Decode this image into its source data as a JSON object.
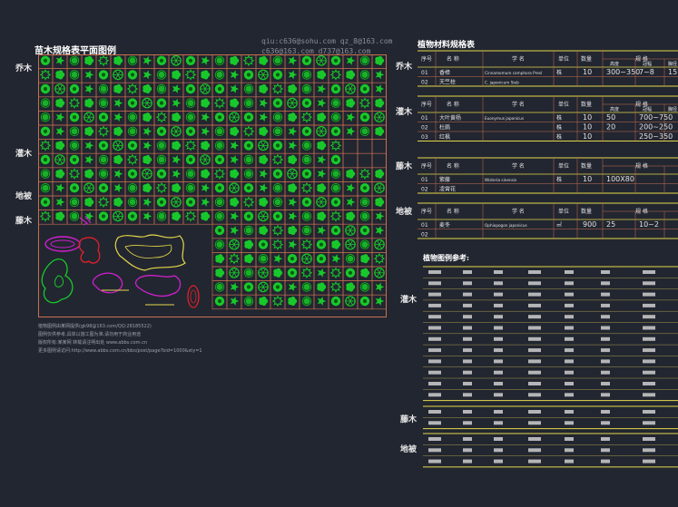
{
  "header": {
    "title": "苗木规格表平面图例",
    "watermark_top": "qiu:c636@sohu.com  qz_8@163.com",
    "watermark_bottom": "c636@163.com  d737@163.com"
  },
  "left_labels": {
    "arbor": "乔木",
    "shrub": "灌木",
    "ground": "地被",
    "cover": "藤木"
  },
  "notes": [
    "植物图例由某网提供(gk98@163.com/QQ:28185522)",
    "图例仅供参考,具体以施工图为准,请勿用于商业用途",
    "版权所有:某某网 转载请注明出处 www.abbs.com.cn",
    "更多图例请访问:http://www.abbs.com.cn/bbs/post/page?bid=1000&sty=1"
  ],
  "right": {
    "title": "植物材料规格表",
    "section_labels": {
      "arbor": "乔木",
      "shrub": "灌木",
      "ground": "藤木",
      "cover": "地被"
    },
    "table_headers": [
      "序号",
      "名  称",
      "学  名",
      "单位",
      "数量",
      "规 格"
    ],
    "spec_sub": [
      "高度",
      "冠幅",
      "胸径"
    ],
    "table_arbor": [
      [
        "01",
        "香樟",
        "Cinnamomum camphora Presl",
        "株",
        "10",
        "300~350",
        "7~8",
        "15"
      ],
      [
        "02",
        "天竺桂",
        "C. japonicum Sieb",
        "",
        " ",
        "",
        "",
        ""
      ]
    ],
    "table_shrub": [
      [
        "01",
        "大叶黄杨",
        "Euonymus japonicus",
        "株",
        "10",
        "50",
        "700~750",
        ""
      ],
      [
        "02",
        "杜鹃",
        "",
        "株",
        "10",
        "20",
        "200~250",
        ""
      ],
      [
        "03",
        "红枫",
        "",
        "株",
        "10",
        "",
        "250~350",
        ""
      ]
    ],
    "table_vine": [
      [
        "01",
        "紫藤",
        "Wisteria sinensis",
        "株",
        "10",
        "100X80",
        ""
      ],
      [
        "02",
        "凌霄花",
        "",
        "",
        "",
        "",
        ""
      ]
    ],
    "table_cover": [
      [
        "01",
        "麦冬",
        "Ophiopogon japonicus",
        "㎡",
        "900",
        "25",
        "10~2"
      ],
      [
        "02",
        "",
        "",
        "",
        "",
        "",
        ""
      ]
    ],
    "list_title": "植物图例参考:",
    "list_labels": {
      "shrub": "灌木",
      "vine": "藤木",
      "cover": "地被"
    }
  },
  "colors": {
    "bg": "#222630",
    "green": "#18c82a",
    "magenta": "#d020d0",
    "red": "#e0202a",
    "yellow": "#e6d84a",
    "grid": "#c87050"
  }
}
